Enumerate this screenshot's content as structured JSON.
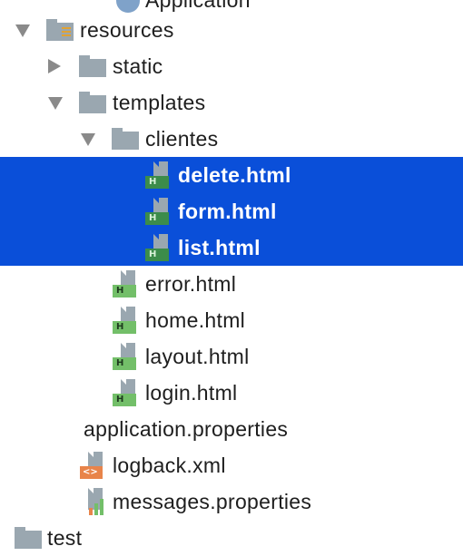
{
  "tree": {
    "items": [
      {
        "label": "Application"
      },
      {
        "label": "resources"
      },
      {
        "label": "static"
      },
      {
        "label": "templates"
      },
      {
        "label": "clientes"
      },
      {
        "label": "delete.html"
      },
      {
        "label": "form.html"
      },
      {
        "label": "list.html"
      },
      {
        "label": "error.html"
      },
      {
        "label": "home.html"
      },
      {
        "label": "layout.html"
      },
      {
        "label": "login.html"
      },
      {
        "label": "application.properties"
      },
      {
        "label": "logback.xml"
      },
      {
        "label": "messages.properties"
      },
      {
        "label": "test"
      }
    ]
  },
  "icons": {
    "folder": "folder-icon",
    "resources_folder": "resources-folder-icon",
    "html_file": "html-file-icon",
    "xml_file": "xml-file-icon",
    "properties_file": "properties-file-icon",
    "application_icon": "application-icon"
  },
  "colors": {
    "selection": "#0a4fd9",
    "folder": "#9aa7b0",
    "html_badge": "#73bf69",
    "xml_badge": "#e8844a"
  }
}
